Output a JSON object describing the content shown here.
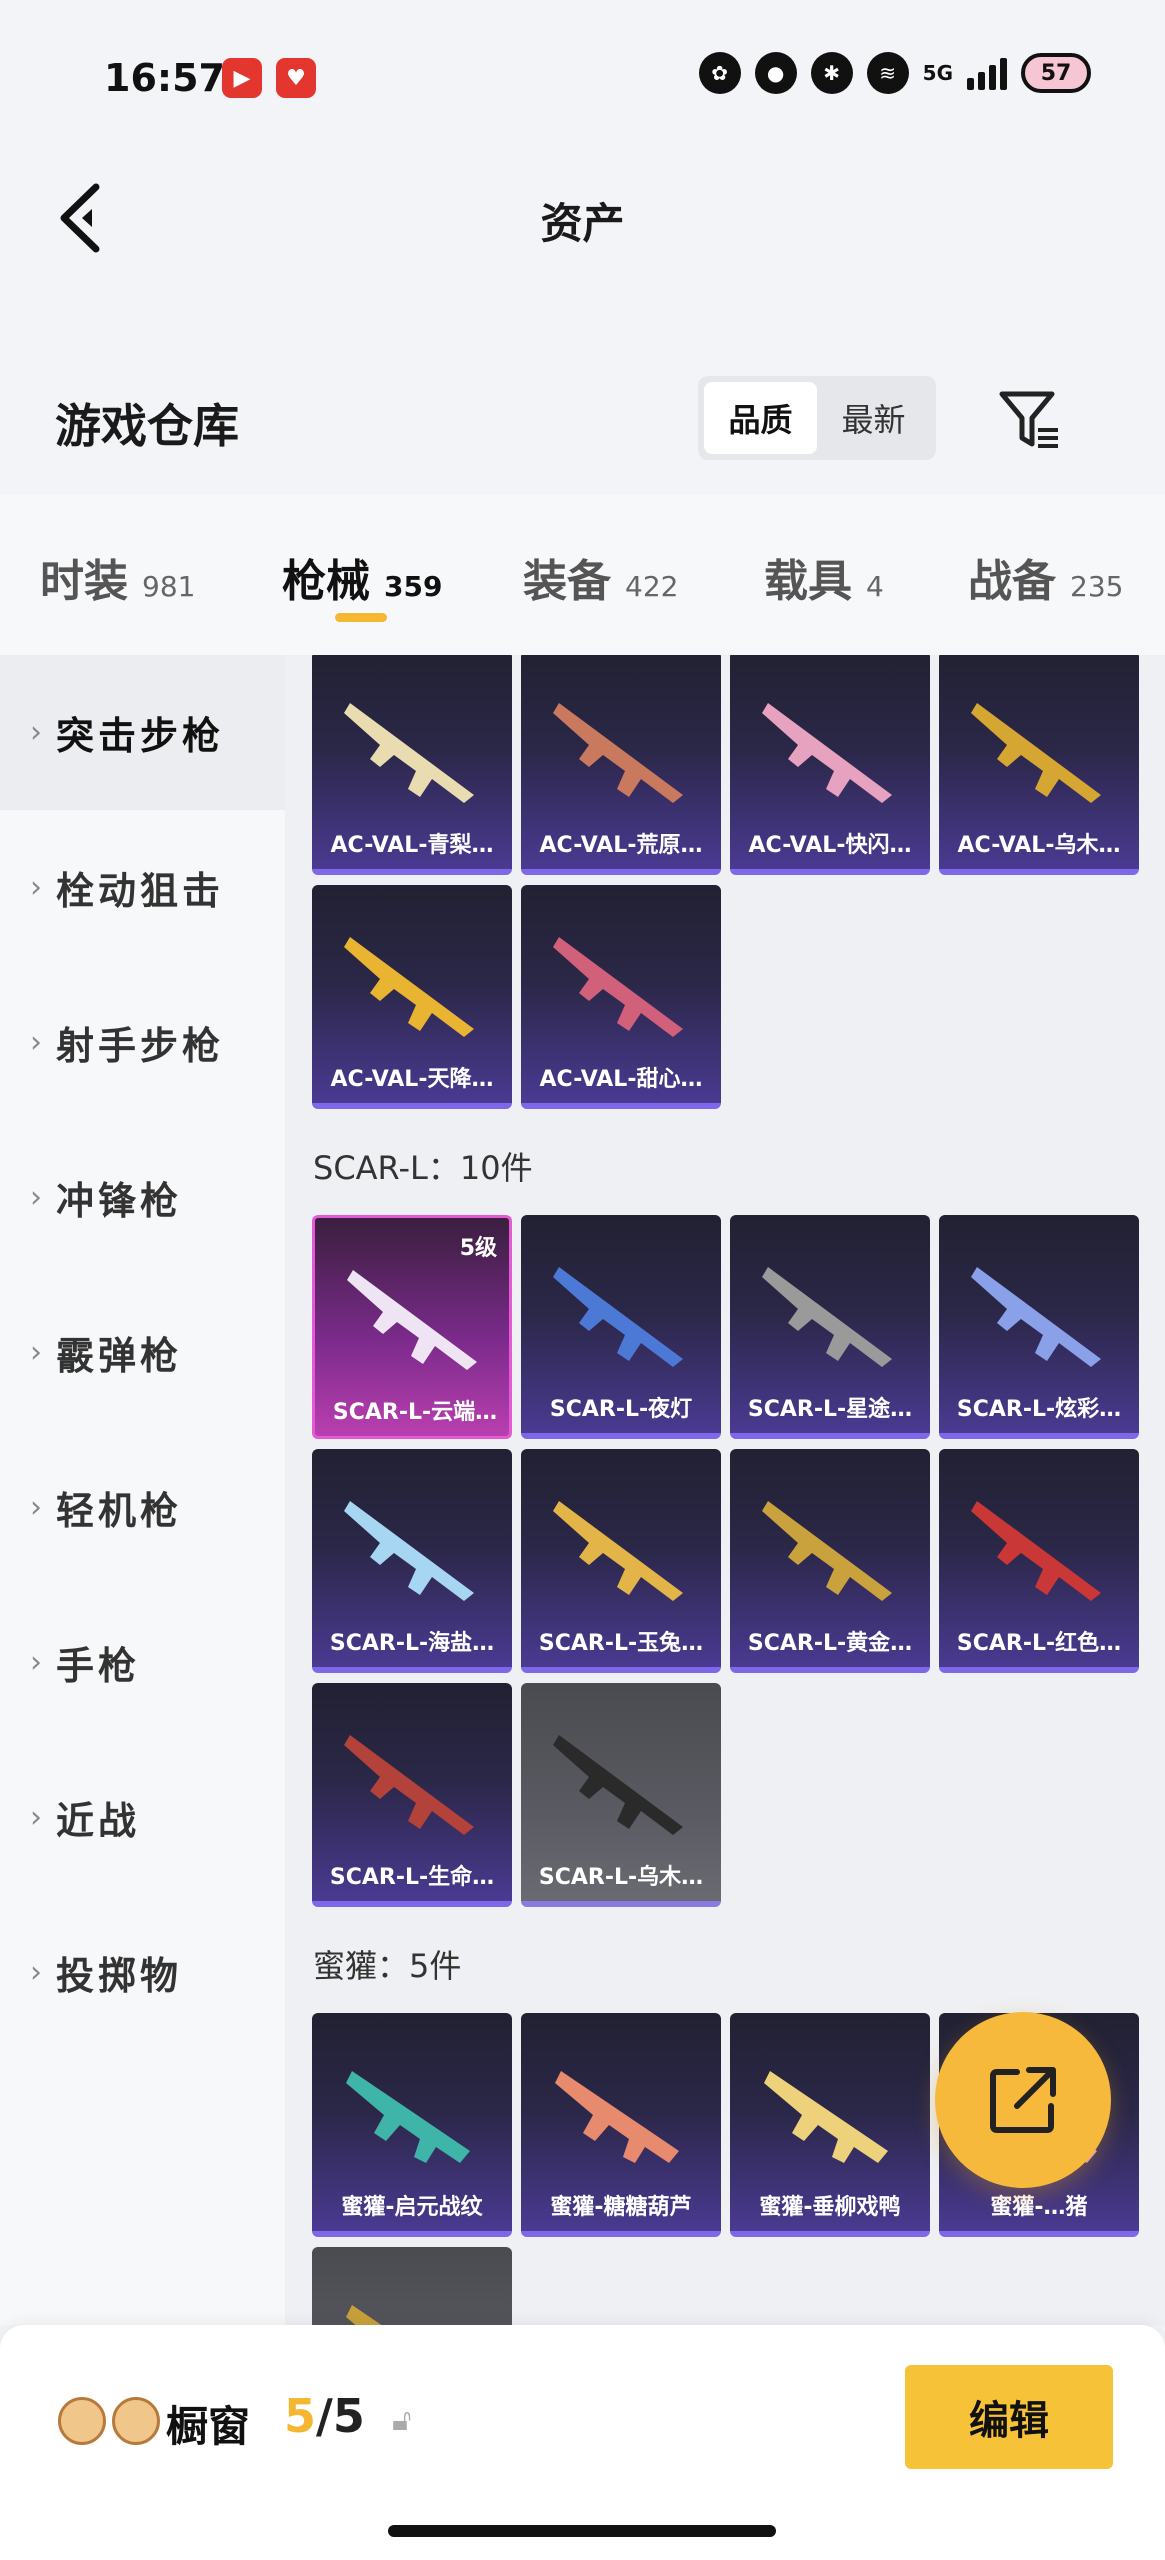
{
  "status_bar": {
    "time": "16:57",
    "network": "5G",
    "battery": "57"
  },
  "nav": {
    "title": "资产"
  },
  "warehouse": {
    "title": "游戏仓库",
    "sort_options": [
      "品质",
      "最新"
    ],
    "active_sort": "品质"
  },
  "category_tabs": [
    {
      "label": "时装",
      "count": "981"
    },
    {
      "label": "枪械",
      "count": "359"
    },
    {
      "label": "装备",
      "count": "422"
    },
    {
      "label": "载具",
      "count": "4"
    },
    {
      "label": "战备",
      "count": "235"
    }
  ],
  "sidebar": {
    "items": [
      {
        "label": "突击步枪"
      },
      {
        "label": "栓动狙击"
      },
      {
        "label": "射手步枪"
      },
      {
        "label": "冲锋枪"
      },
      {
        "label": "霰弹枪"
      },
      {
        "label": "轻机枪"
      },
      {
        "label": "手枪"
      },
      {
        "label": "近战"
      },
      {
        "label": "投掷物"
      }
    ]
  },
  "groups": {
    "acval": {
      "items": [
        {
          "name": "AC-VAL-青梨…",
          "color": "#e8dcb0"
        },
        {
          "name": "AC-VAL-荒原…",
          "color": "#c9795e"
        },
        {
          "name": "AC-VAL-快闪…",
          "color": "#e7a2c0"
        },
        {
          "name": "AC-VAL-乌木…",
          "color": "#d6a632"
        },
        {
          "name": "AC-VAL-天降…",
          "color": "#e9b431"
        },
        {
          "name": "AC-VAL-甜心…",
          "color": "#d1607a"
        }
      ]
    },
    "scar": {
      "label": "SCAR-L：10件",
      "items": [
        {
          "name": "SCAR-L-云端…",
          "level": "5级",
          "color": "#efe4f3"
        },
        {
          "name": "SCAR-L-夜灯",
          "color": "#4d79d6"
        },
        {
          "name": "SCAR-L-星途…",
          "color": "#9a9a9a"
        },
        {
          "name": "SCAR-L-炫彩…",
          "color": "#8aa0e8"
        },
        {
          "name": "SCAR-L-海盐…",
          "color": "#a6d6f2"
        },
        {
          "name": "SCAR-L-玉兔…",
          "color": "#e3b448"
        },
        {
          "name": "SCAR-L-黄金…",
          "color": "#c9a23e"
        },
        {
          "name": "SCAR-L-红色…",
          "color": "#c93737"
        },
        {
          "name": "SCAR-L-生命…",
          "color": "#b3423a"
        },
        {
          "name": "SCAR-L-乌木…",
          "color": "#2a2a2a"
        }
      ]
    },
    "mihuan": {
      "label": "蜜獾：5件",
      "items": [
        {
          "name": "蜜獾-启元战纹",
          "color": "#3fb4a9"
        },
        {
          "name": "蜜獾-糖糖葫芦",
          "color": "#e78a6d"
        },
        {
          "name": "蜜獾-垂柳戏鸭",
          "color": "#eed27b"
        },
        {
          "name": "蜜獾-…猪",
          "color": "#f2a7c2"
        },
        {
          "name": "",
          "color": "#c7a03a"
        }
      ]
    }
  },
  "bottom_bar": {
    "label": "橱窗",
    "current": "5",
    "max": "/5",
    "edit_label": "编辑"
  },
  "colors": {
    "accent": "#f5b731",
    "card_rare": "#7f67ea",
    "card_legendary": "#e35ad4"
  }
}
